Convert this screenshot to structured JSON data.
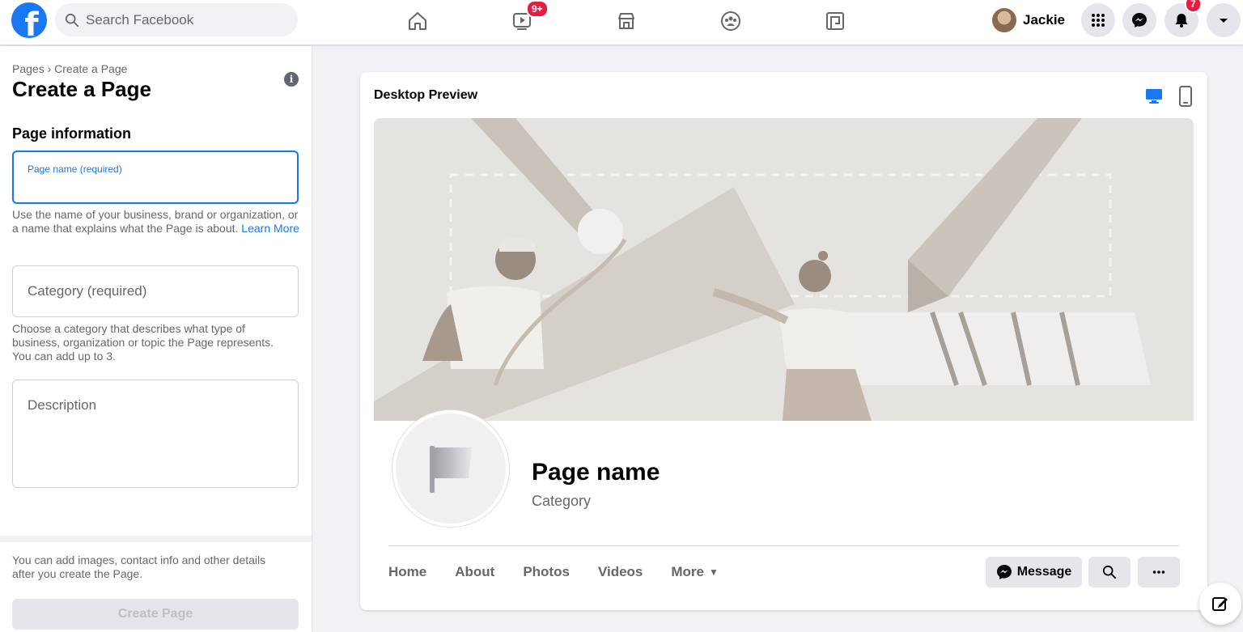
{
  "topbar": {
    "search_placeholder": "Search Facebook",
    "logo_icon": "facebook-logo",
    "nav_icons": [
      "home-icon",
      "watch-icon",
      "marketplace-icon",
      "groups-icon",
      "gaming-icon"
    ],
    "watch_badge": "9+",
    "profile_name": "Jackie",
    "notifications_badge": "7",
    "right_icons": [
      "menu-grid-icon",
      "messenger-icon",
      "bell-icon",
      "caret-down-icon"
    ]
  },
  "left": {
    "breadcrumb": "Pages › Create a Page",
    "title": "Create a Page",
    "section": "Page information",
    "page_name_label": "Page name (required)",
    "page_name_value": "",
    "page_name_help": "Use the name of your business, brand or organization, or a name that explains what the Page is about.",
    "learn_more": "Learn More",
    "category_placeholder": "Category (required)",
    "category_help": "Choose a category that describes what type of business, organization or topic the Page represents. You can add up to 3.",
    "description_placeholder": "Description",
    "footer_text": "You can add images, contact info and other details after you create the Page.",
    "create_button": "Create Page"
  },
  "preview": {
    "title": "Desktop Preview",
    "page_name": "Page name",
    "category": "Category",
    "tabs": [
      "Home",
      "About",
      "Photos",
      "Videos",
      "More"
    ],
    "message_button": "Message"
  },
  "colors": {
    "brand": "#1877f2",
    "badge": "#e41e3f",
    "background": "#f0f2f5"
  }
}
